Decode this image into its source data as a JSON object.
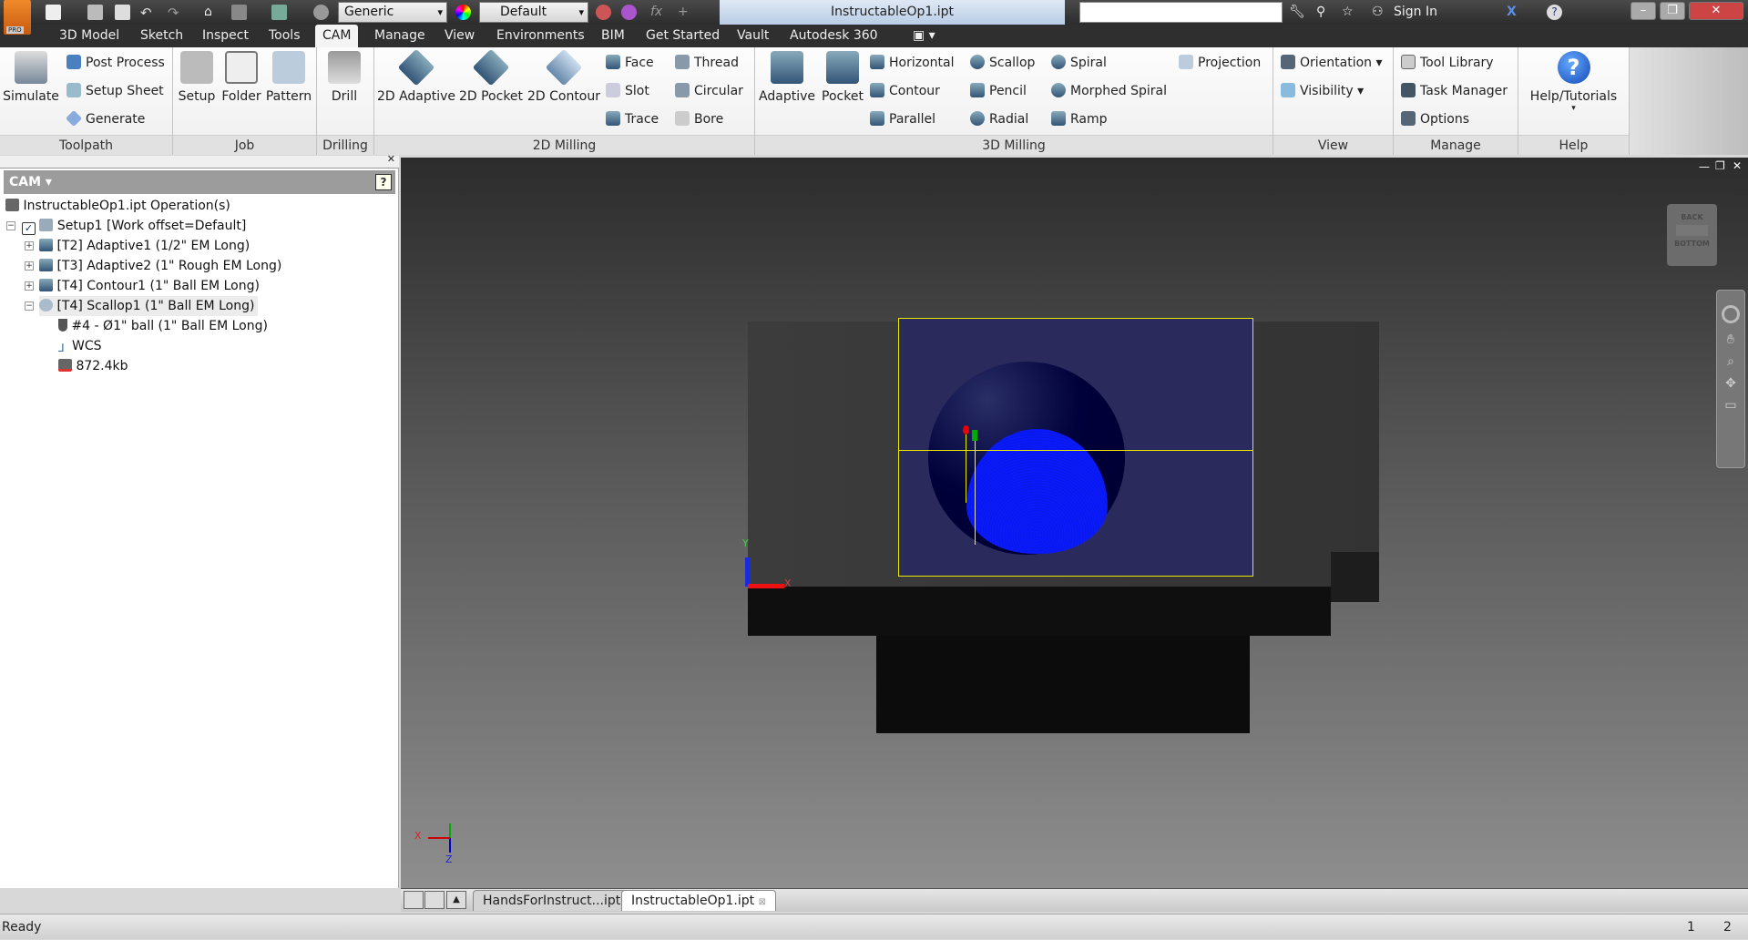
{
  "titlebar": {
    "document_title": "InstructableOp1.ipt",
    "material_combo": "Generic",
    "appearance_combo": "Default",
    "sign_in": "Sign In",
    "app_badge": "PRO"
  },
  "tabs": [
    "3D Model",
    "Sketch",
    "Inspect",
    "Tools",
    "CAM",
    "Manage",
    "View",
    "Environments",
    "BIM",
    "Get Started",
    "Vault",
    "Autodesk 360"
  ],
  "active_tab": "CAM",
  "ribbon": {
    "toolpath": {
      "label": "Toolpath",
      "simulate": "Simulate",
      "post_process": "Post Process",
      "setup_sheet": "Setup Sheet",
      "generate": "Generate"
    },
    "job": {
      "label": "Job",
      "setup": "Setup",
      "folder": "Folder",
      "pattern": "Pattern"
    },
    "drilling": {
      "label": "Drilling",
      "drill": "Drill"
    },
    "milling2d": {
      "label": "2D Milling",
      "adaptive": "2D Adaptive",
      "pocket": "2D Pocket",
      "contour": "2D Contour",
      "face": "Face",
      "slot": "Slot",
      "trace": "Trace",
      "thread": "Thread",
      "circular": "Circular",
      "bore": "Bore"
    },
    "milling3d": {
      "label": "3D Milling",
      "adaptive": "Adaptive",
      "pocket": "Pocket",
      "horizontal": "Horizontal",
      "contour": "Contour",
      "parallel": "Parallel",
      "scallop": "Scallop",
      "pencil": "Pencil",
      "radial": "Radial",
      "spiral": "Spiral",
      "morphed_spiral": "Morphed Spiral",
      "ramp": "Ramp",
      "projection": "Projection"
    },
    "view": {
      "label": "View",
      "orientation": "Orientation",
      "visibility": "Visibility"
    },
    "manage": {
      "label": "Manage",
      "tool_library": "Tool Library",
      "task_manager": "Task Manager",
      "options": "Options"
    },
    "help": {
      "label": "Help",
      "help_tutorials": "Help/Tutorials"
    }
  },
  "browser": {
    "header": "CAM",
    "tree": [
      "InstructableOp1.ipt Operation(s)",
      "Setup1 [Work offset=Default]",
      "[T2] Adaptive1 (1/2\" EM Long)",
      "[T3] Adaptive2 (1\" Rough EM Long)",
      "[T4] Contour1 (1\" Ball EM Long)",
      "[T4] Scallop1 (1\" Ball EM Long)",
      "#4 - Ø1\" ball (1\" Ball EM Long)",
      "WCS",
      "872.4kb"
    ]
  },
  "viewport": {
    "viewcube_top": "BACK",
    "viewcube_bottom": "BOTTOM",
    "axis_x": "X",
    "axis_y": "Y",
    "axis_z": "Z",
    "toolpath_color": "#0a1aff",
    "stock_box_color": "#e8e800"
  },
  "document_tabs": [
    "HandsForInstruct...ipt",
    "InstructableOp1.ipt"
  ],
  "status": {
    "text": "Ready",
    "count1": "1",
    "count2": "2"
  }
}
